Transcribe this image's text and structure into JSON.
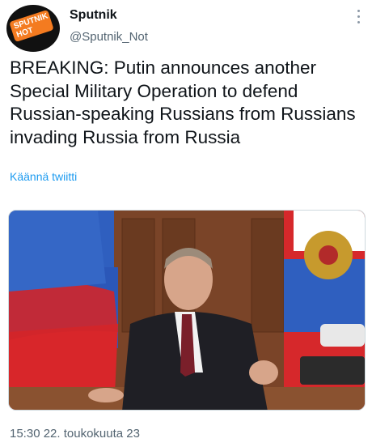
{
  "tweet": {
    "display_name": "Sputnik",
    "handle": "@Sputnik_Not",
    "avatar_text": "SPUTNIK НОТ",
    "text": "BREAKING: Putin announces another Special Military Operation to defend Russian-speaking Russians from Russians invading Russia from Russia",
    "translate_label": "Käännä twiitti",
    "timestamp": "15:30 22. toukokuuta 23",
    "more_icon": "more-options-icon"
  },
  "colors": {
    "avatar_bg": "#111111",
    "avatar_accent": "#f47b20",
    "link": "#1d9bf0",
    "secondary_text": "#536471"
  }
}
